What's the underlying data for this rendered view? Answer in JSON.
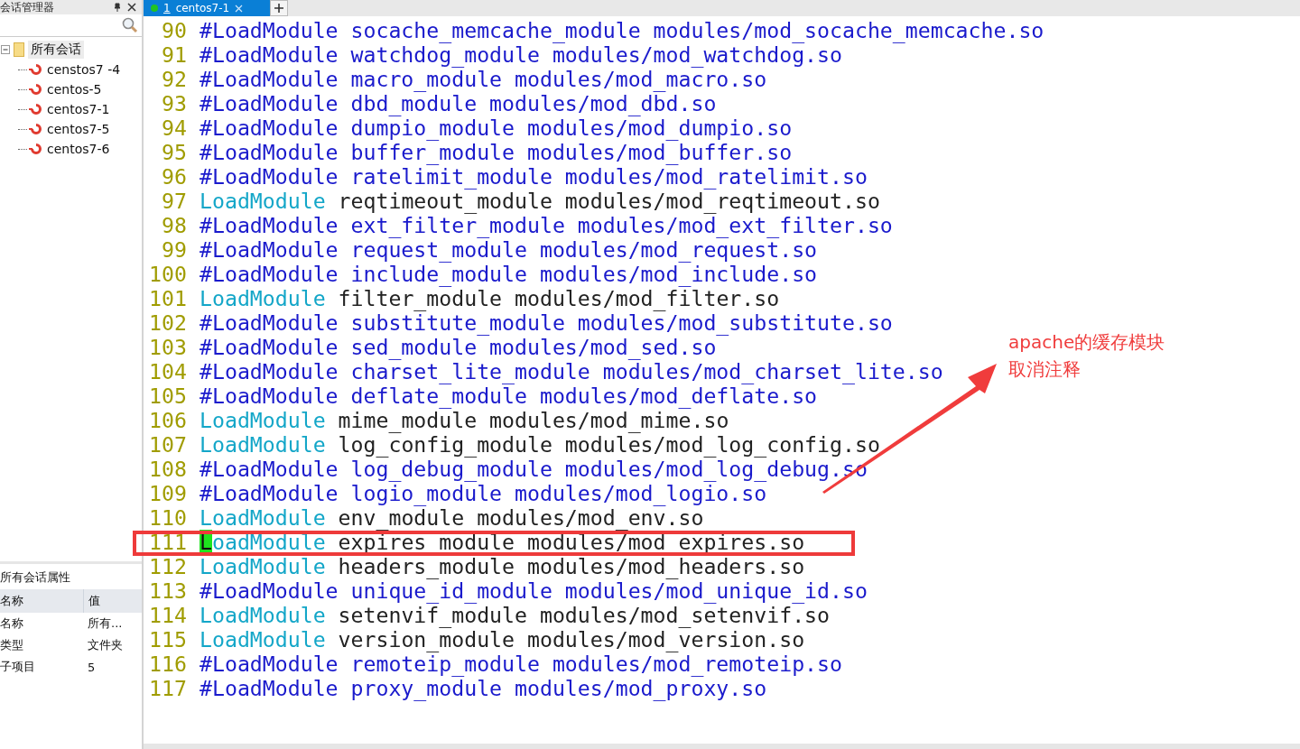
{
  "session_manager": {
    "title": "会话管理器",
    "tree": [
      {
        "label": "所有会话",
        "expanded": true,
        "selected": true,
        "children": [
          {
            "label": "censtos7 -4"
          },
          {
            "label": "centos-5"
          },
          {
            "label": "centos7-1"
          },
          {
            "label": "centos7-5"
          },
          {
            "label": "centos7-6"
          }
        ]
      }
    ]
  },
  "properties": {
    "title": "所有会话属性",
    "columns": [
      "名称",
      "值"
    ],
    "rows": [
      {
        "name": "名称",
        "value": "所有..."
      },
      {
        "name": "类型",
        "value": "文件夹"
      },
      {
        "name": "子项目",
        "value": "5"
      }
    ]
  },
  "tabs": [
    {
      "number": "1",
      "label": "centos7-1",
      "selected": true,
      "connected": true
    }
  ],
  "editor": {
    "lines": [
      {
        "number": "90",
        "commented": true,
        "keyword": "#LoadModule",
        "args": "socache_memcache_module modules/mod_socache_memcache.so",
        "cursor": false
      },
      {
        "number": "91",
        "commented": true,
        "keyword": "#LoadModule",
        "args": "watchdog_module modules/mod_watchdog.so",
        "cursor": false
      },
      {
        "number": "92",
        "commented": true,
        "keyword": "#LoadModule",
        "args": "macro_module modules/mod_macro.so",
        "cursor": false
      },
      {
        "number": "93",
        "commented": true,
        "keyword": "#LoadModule",
        "args": "dbd_module modules/mod_dbd.so",
        "cursor": false
      },
      {
        "number": "94",
        "commented": true,
        "keyword": "#LoadModule",
        "args": "dumpio_module modules/mod_dumpio.so",
        "cursor": false
      },
      {
        "number": "95",
        "commented": true,
        "keyword": "#LoadModule",
        "args": "buffer_module modules/mod_buffer.so",
        "cursor": false
      },
      {
        "number": "96",
        "commented": true,
        "keyword": "#LoadModule",
        "args": "ratelimit_module modules/mod_ratelimit.so",
        "cursor": false
      },
      {
        "number": "97",
        "commented": false,
        "keyword": "LoadModule",
        "args": "reqtimeout_module modules/mod_reqtimeout.so",
        "cursor": false
      },
      {
        "number": "98",
        "commented": true,
        "keyword": "#LoadModule",
        "args": "ext_filter_module modules/mod_ext_filter.so",
        "cursor": false
      },
      {
        "number": "99",
        "commented": true,
        "keyword": "#LoadModule",
        "args": "request_module modules/mod_request.so",
        "cursor": false
      },
      {
        "number": "100",
        "commented": true,
        "keyword": "#LoadModule",
        "args": "include_module modules/mod_include.so",
        "cursor": false
      },
      {
        "number": "101",
        "commented": false,
        "keyword": "LoadModule",
        "args": "filter_module modules/mod_filter.so",
        "cursor": false
      },
      {
        "number": "102",
        "commented": true,
        "keyword": "#LoadModule",
        "args": "substitute_module modules/mod_substitute.so",
        "cursor": false
      },
      {
        "number": "103",
        "commented": true,
        "keyword": "#LoadModule",
        "args": "sed_module modules/mod_sed.so",
        "cursor": false
      },
      {
        "number": "104",
        "commented": true,
        "keyword": "#LoadModule",
        "args": "charset_lite_module modules/mod_charset_lite.so",
        "cursor": false
      },
      {
        "number": "105",
        "commented": true,
        "keyword": "#LoadModule",
        "args": "deflate_module modules/mod_deflate.so",
        "cursor": false
      },
      {
        "number": "106",
        "commented": false,
        "keyword": "LoadModule",
        "args": "mime_module modules/mod_mime.so",
        "cursor": false
      },
      {
        "number": "107",
        "commented": false,
        "keyword": "LoadModule",
        "args": "log_config_module modules/mod_log_config.so",
        "cursor": false
      },
      {
        "number": "108",
        "commented": true,
        "keyword": "#LoadModule",
        "args": "log_debug_module modules/mod_log_debug.so",
        "cursor": false
      },
      {
        "number": "109",
        "commented": true,
        "keyword": "#LoadModule",
        "args": "logio_module modules/mod_logio.so",
        "cursor": false
      },
      {
        "number": "110",
        "commented": false,
        "keyword": "LoadModule",
        "args": "env_module modules/mod_env.so",
        "cursor": false
      },
      {
        "number": "111",
        "commented": false,
        "keyword": "LoadModule",
        "args": "expires_module modules/mod_expires.so",
        "cursor": true,
        "highlighted": true
      },
      {
        "number": "112",
        "commented": false,
        "keyword": "LoadModule",
        "args": "headers_module modules/mod_headers.so",
        "cursor": false
      },
      {
        "number": "113",
        "commented": true,
        "keyword": "#LoadModule",
        "args": "unique_id_module modules/mod_unique_id.so",
        "cursor": false
      },
      {
        "number": "114",
        "commented": false,
        "keyword": "LoadModule",
        "args": "setenvif_module modules/mod_setenvif.so",
        "cursor": false
      },
      {
        "number": "115",
        "commented": false,
        "keyword": "LoadModule",
        "args": "version_module modules/mod_version.so",
        "cursor": false
      },
      {
        "number": "116",
        "commented": true,
        "keyword": "#LoadModule",
        "args": "remoteip_module modules/mod_remoteip.so",
        "cursor": false
      },
      {
        "number": "117",
        "commented": true,
        "keyword": "#LoadModule",
        "args": "proxy_module modules/mod_proxy.so",
        "cursor": false
      }
    ]
  },
  "annotation": {
    "lines": [
      "apache的缓存模块",
      "取消注释"
    ]
  }
}
